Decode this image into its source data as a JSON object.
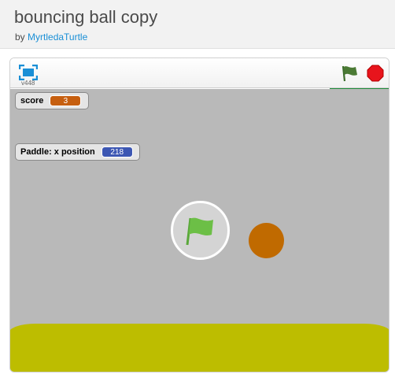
{
  "project": {
    "title": "bouncing ball copy",
    "by_label": "by",
    "author": "MyrtledaTurtle"
  },
  "player": {
    "version": "v448",
    "fullscreen_icon": "fullscreen-icon",
    "green_flag_icon": "green-flag-icon",
    "stop_icon": "stop-icon",
    "colors": {
      "stage": "#b9b9b9",
      "ground": "#bdbd00",
      "ball": "#c06a00",
      "running_indicator": "#1e8c3a"
    }
  },
  "monitors": {
    "score": {
      "label": "score",
      "value": "3"
    },
    "paddle": {
      "label": "Paddle: x position",
      "value": "218"
    }
  }
}
